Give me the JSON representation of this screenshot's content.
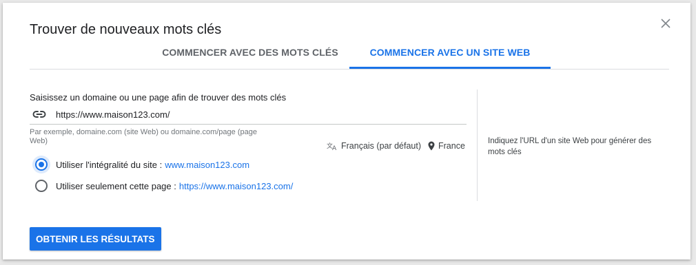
{
  "dialog": {
    "title": "Trouver de nouveaux mots clés",
    "close_icon": "close-icon"
  },
  "tabs": [
    {
      "label": "COMMENCER AVEC DES MOTS CLÉS",
      "active": false
    },
    {
      "label": "COMMENCER AVEC UN SITE WEB",
      "active": true
    }
  ],
  "form": {
    "prompt": "Saisissez un domaine ou une page afin de trouver des mots clés",
    "url_icon": "link-icon",
    "url_value": "https://www.maison123.com/",
    "hint": "Par exemple, domaine.com (site Web) ou domaine.com/page (page Web)",
    "language": "Français (par défaut)",
    "language_icon": "translate-icon",
    "location": "France",
    "location_icon": "location-pin-icon",
    "options": [
      {
        "label": "Utiliser l'intégralité du site :",
        "link": "www.maison123.com",
        "checked": true
      },
      {
        "label": "Utiliser seulement cette page :",
        "link": "https://www.maison123.com/",
        "checked": false
      }
    ]
  },
  "side_note": "Indiquez l'URL d'un site Web pour générer des mots clés",
  "submit_label": "OBTENIR LES RÉSULTATS",
  "colors": {
    "accent": "#1a73e8",
    "text": "#202124",
    "muted": "#5f6368",
    "divider": "#dadce0"
  }
}
